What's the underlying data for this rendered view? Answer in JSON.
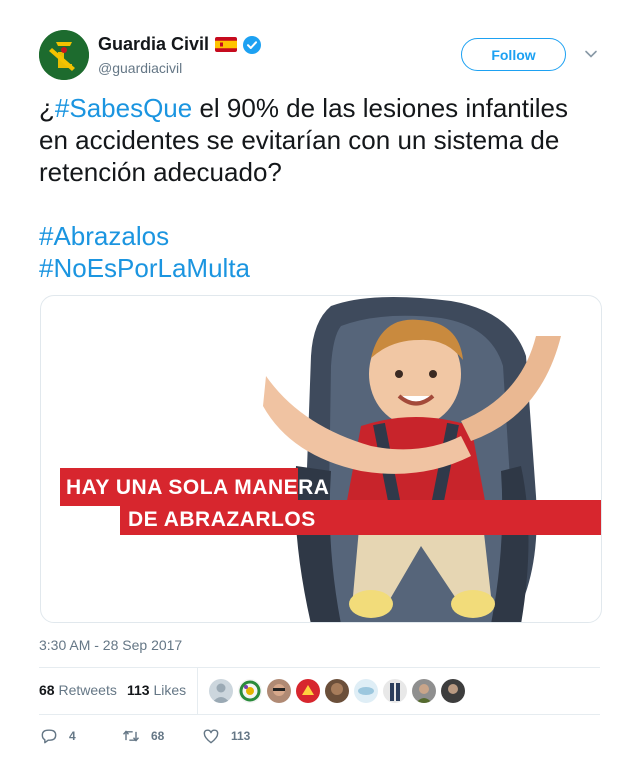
{
  "author": {
    "display_name": "Guardia Civil",
    "handle": "@guardiacivil",
    "verified": true,
    "flag": "spain-flag-icon"
  },
  "follow_label": "Follow",
  "tweet": {
    "line1_prefix": "¿",
    "line1_hashtag": "#SabesQue",
    "line1_rest": " el 90% de las lesiones infantiles en accidentes se evitarían con un sistema de retención adecuado?",
    "hashtag_1": "#Abrazalos",
    "hashtag_2": "#NoEsPorLaMulta"
  },
  "media": {
    "banner_line1": "HAY UNA SOLA MANERA",
    "banner_line2": "DE ABRAZARLOS",
    "banner_color": "#d7262e"
  },
  "timestamp": "3:30 AM - 28 Sep 2017",
  "stats": {
    "retweets_count": "68",
    "retweets_label": "Retweets",
    "likes_count": "113",
    "likes_label": "Likes"
  },
  "actions": {
    "reply_count": "4",
    "retweet_count": "68",
    "like_count": "113"
  },
  "colors": {
    "accent": "#1da1f2",
    "hashtag": "#1b95e0",
    "muted": "#657786",
    "brand_green": "#1d6b2e"
  }
}
